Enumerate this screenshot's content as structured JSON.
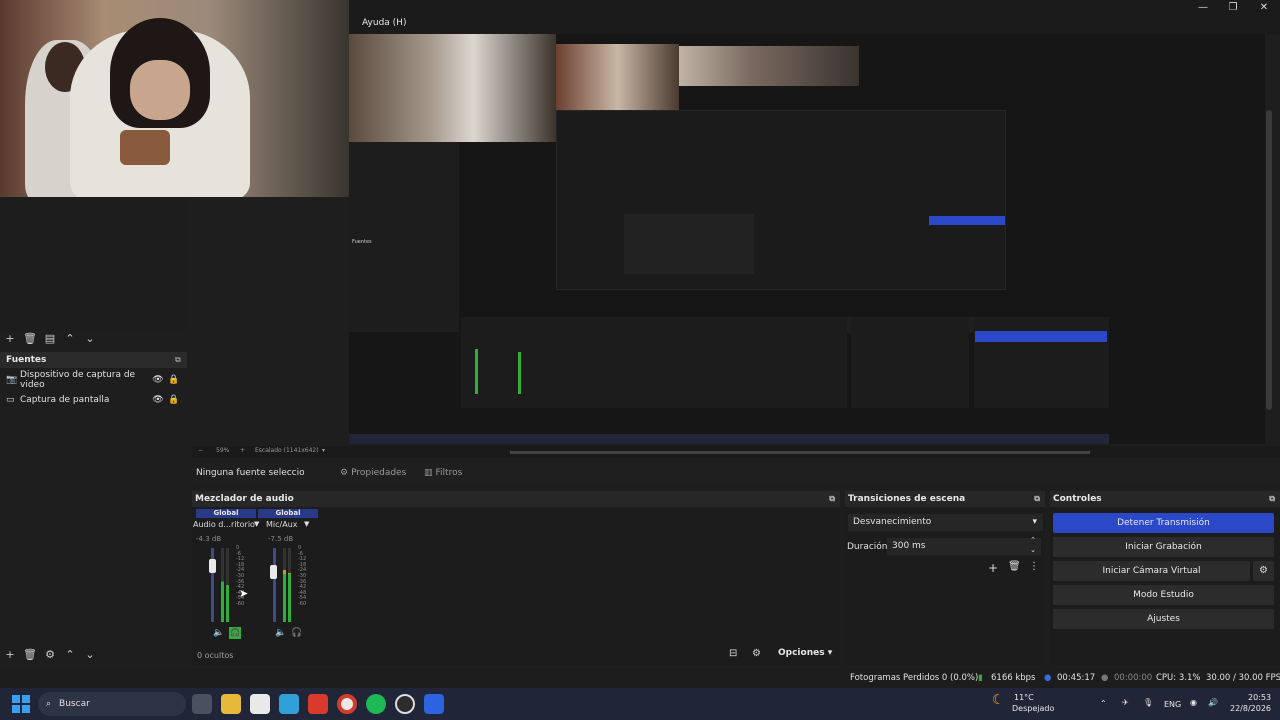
{
  "menu": {
    "help": "Ayuda (H)"
  },
  "sources": {
    "title": "Fuentes",
    "items": [
      {
        "label": "Dispositivo de captura de video"
      },
      {
        "label": "Captura de pantalla"
      }
    ]
  },
  "preview": {
    "zoom": "59%",
    "scale": "Escalado (1141x642)"
  },
  "properties_bar": {
    "no_source": "Ninguna fuente seleccionada",
    "properties": "Propiedades",
    "filters": "Filtros"
  },
  "mixer": {
    "title": "Mezclador de audio",
    "channels": [
      {
        "tab": "Global",
        "name": "Audio d...ritorio",
        "db": "-4.3 dB",
        "level": 0.55
      },
      {
        "tab": "Global",
        "name": "Mic/Aux",
        "db": "-7.5 dB",
        "level": 0.7
      }
    ],
    "scale": [
      "0",
      "-6",
      "-12",
      "-18",
      "-24",
      "-30",
      "-36",
      "-42",
      "-48",
      "-54",
      "-60"
    ],
    "hidden": "0 ocultos",
    "options": "Opciones"
  },
  "transitions": {
    "title": "Transiciones de escena",
    "selected": "Desvanecimiento",
    "duration_label": "Duración",
    "duration_value": "300 ms"
  },
  "controls": {
    "title": "Controles",
    "stop_stream": "Detener Transmisión",
    "start_recording": "Iniciar Grabación",
    "virtual_camera": "Iniciar Cámara Virtual",
    "studio_mode": "Modo Estudio",
    "settings": "Ajustes"
  },
  "status": {
    "dropped": "Fotogramas Perdidos 0 (0.0%)",
    "bitrate": "6166 kbps",
    "stream_time": "00:45:17",
    "rec_time": "00:00:00",
    "cpu": "CPU: 3.1%",
    "fps": "30.00 / 30.00 FPS"
  },
  "taskbar": {
    "search": "Buscar",
    "weather_temp": "11°C",
    "weather_desc": "Despejado",
    "lang": "ENG",
    "time": "20:53",
    "date": "22/8/2026"
  },
  "colors": {
    "accent": "#2b48c8",
    "meter_green": "#2fae3a",
    "meter_yellow": "#b8a020",
    "meter_red": "#b02828"
  }
}
